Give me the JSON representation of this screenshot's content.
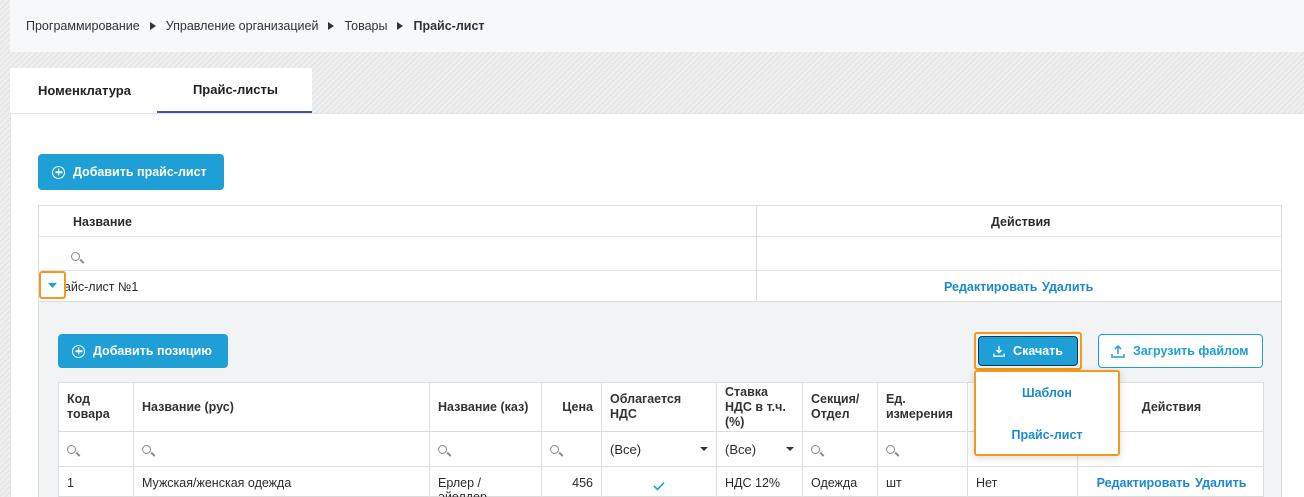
{
  "breadcrumb": {
    "items": [
      "Программирование",
      "Управление организацией",
      "Товары"
    ],
    "current": "Прайс-лист"
  },
  "tabs": [
    {
      "label": "Номенклатура",
      "active": false
    },
    {
      "label": "Прайс-листы",
      "active": true
    }
  ],
  "pricelists": {
    "add_button": "Добавить прайс-лист",
    "columns": {
      "name": "Название",
      "actions": "Действия"
    },
    "rows": [
      {
        "name": "Прайс-лист №1",
        "edit": "Редактировать",
        "delete": "Удалить"
      }
    ]
  },
  "detail": {
    "add_position_button": "Добавить позицию",
    "download_button": "Скачать",
    "upload_button": "Загрузить файлом",
    "download_menu": [
      "Шаблон",
      "Прайс-лист"
    ],
    "columns": [
      "Код товара",
      "Название (рус)",
      "Название (каз)",
      "Цена",
      "Облагается НДС",
      "Ставка НДС в т.ч.(%)",
      "Секция/ Отдел",
      "Ед. измерения",
      "",
      "Действия"
    ],
    "filters": {
      "vat_taxable": "(Все)",
      "vat_rate": "(Все)"
    },
    "rows": [
      {
        "code": "1",
        "name_ru": "Мужская/женская одежда",
        "name_kz": "Ерлер / әйелдер",
        "price": "456",
        "vat_taxable": true,
        "vat_rate": "НДС 12%",
        "section": "Одежда",
        "unit": "шт",
        "extra": "Нет",
        "edit": "Редактировать",
        "delete": "Удалить"
      }
    ]
  },
  "colors": {
    "primary": "#1e9fd6",
    "link": "#1a8ad0",
    "highlight": "#f39a1e",
    "tab_underline": "#3f51b5"
  }
}
